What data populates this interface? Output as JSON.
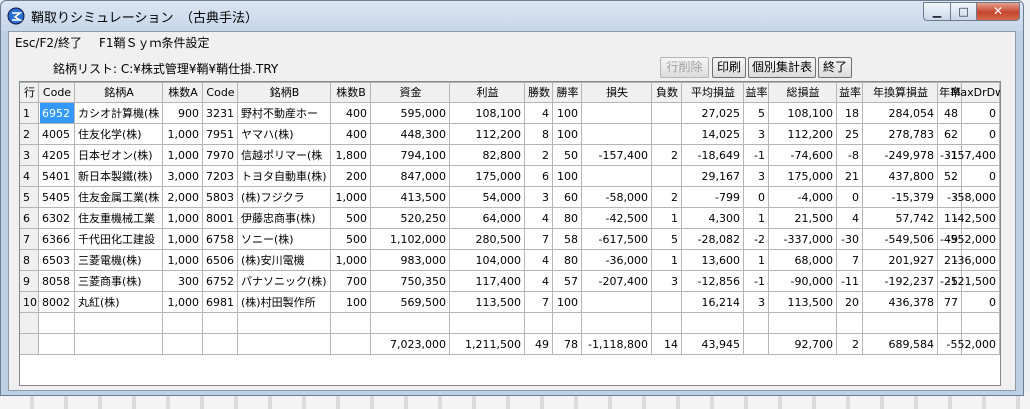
{
  "window": {
    "title": "鞘取りシミュレーション　（古典手法）",
    "min_glyph": "▁",
    "max_glyph": "□",
    "close_glyph": "✕"
  },
  "menu": [
    "Esc/F2/終了",
    "F1鞘Ｓｙｍ条件設定"
  ],
  "list_label": "銘柄リスト: C:¥株式管理¥鞘¥鞘仕掛.TRY",
  "buttons": {
    "delete_row": "行削除",
    "print": "印刷",
    "individual_summary": "個別集計表",
    "exit": "終了"
  },
  "table": {
    "columns": [
      "行",
      "Code",
      "銘柄A",
      "株数A",
      "Code",
      "銘柄B",
      "株数B",
      "資金",
      "利益",
      "勝数",
      "勝率",
      "損失",
      "負数",
      "平均損益",
      "益率",
      "総損益",
      "益率",
      "年換算損益",
      "年率",
      "MaxDrDwn"
    ],
    "rows": [
      [
        "1",
        "6952",
        "カシオ計算機(株",
        "900",
        "3231",
        "野村不動産ホー",
        "400",
        "595,000",
        "108,100",
        "4",
        "100",
        "",
        "",
        "27,025",
        "5",
        "108,100",
        "18",
        "284,054",
        "48",
        "0"
      ],
      [
        "2",
        "4005",
        "住友化学(株)",
        "1,000",
        "7951",
        "ヤマハ(株)",
        "400",
        "448,300",
        "112,200",
        "8",
        "100",
        "",
        "",
        "14,025",
        "3",
        "112,200",
        "25",
        "278,783",
        "62",
        "0"
      ],
      [
        "3",
        "4205",
        "日本ゼオン(株)",
        "1,000",
        "7970",
        "信越ポリマー(株",
        "1,800",
        "794,100",
        "82,800",
        "2",
        "50",
        "-157,400",
        "2",
        "-18,649",
        "-1",
        "-74,600",
        "-8",
        "-249,978",
        "-31",
        "-157,400"
      ],
      [
        "4",
        "5401",
        "新日本製鐵(株)",
        "3,000",
        "7203",
        "トヨタ自動車(株)",
        "200",
        "847,000",
        "175,000",
        "6",
        "100",
        "",
        "",
        "29,167",
        "3",
        "175,000",
        "21",
        "437,800",
        "52",
        "0"
      ],
      [
        "5",
        "5405",
        "住友金属工業(株",
        "2,000",
        "5803",
        "(株)フジクラ",
        "1,000",
        "413,500",
        "54,000",
        "3",
        "60",
        "-58,000",
        "2",
        "-799",
        "0",
        "-4,000",
        "0",
        "-15,379",
        "-3",
        "-58,000"
      ],
      [
        "6",
        "6302",
        "住友重機械工業",
        "1,000",
        "8001",
        "伊藤忠商事(株)",
        "500",
        "520,250",
        "64,000",
        "4",
        "80",
        "-42,500",
        "1",
        "4,300",
        "1",
        "21,500",
        "4",
        "57,742",
        "11",
        "-42,500"
      ],
      [
        "7",
        "6366",
        "千代田化工建設",
        "1,000",
        "6758",
        "ソニー(株)",
        "500",
        "1,102,000",
        "280,500",
        "7",
        "58",
        "-617,500",
        "5",
        "-28,082",
        "-2",
        "-337,000",
        "-30",
        "-549,506",
        "-49",
        "-552,000"
      ],
      [
        "8",
        "6503",
        "三菱電機(株)",
        "1,000",
        "6506",
        "(株)安川電機",
        "1,000",
        "983,000",
        "104,000",
        "4",
        "80",
        "-36,000",
        "1",
        "13,600",
        "1",
        "68,000",
        "7",
        "201,927",
        "21",
        "-36,000"
      ],
      [
        "9",
        "8058",
        "三菱商事(株)",
        "300",
        "6752",
        "パナソニック(株)",
        "700",
        "750,350",
        "117,400",
        "4",
        "57",
        "-207,400",
        "3",
        "-12,856",
        "-1",
        "-90,000",
        "-11",
        "-192,237",
        "-25",
        "-121,500"
      ],
      [
        "10",
        "8002",
        "丸紅(株)",
        "1,000",
        "6981",
        "(株)村田製作所",
        "100",
        "569,500",
        "113,500",
        "7",
        "100",
        "",
        "",
        "16,214",
        "3",
        "113,500",
        "20",
        "436,378",
        "77",
        "0"
      ],
      [
        "",
        "",
        "",
        "",
        "",
        "",
        "",
        "",
        "",
        "",
        "",
        "",
        "",
        "",
        "",
        "",
        "",
        "",
        "",
        ""
      ],
      [
        "",
        "",
        "",
        "",
        "",
        "",
        "",
        "7,023,000",
        "1,211,500",
        "49",
        "78",
        "-1,118,800",
        "14",
        "43,945",
        "",
        "92,700",
        "2",
        "689,584",
        "",
        "-552,000"
      ]
    ]
  },
  "colors": {
    "selected_cell": "#3399ff",
    "accent_red": "#c4452c"
  }
}
